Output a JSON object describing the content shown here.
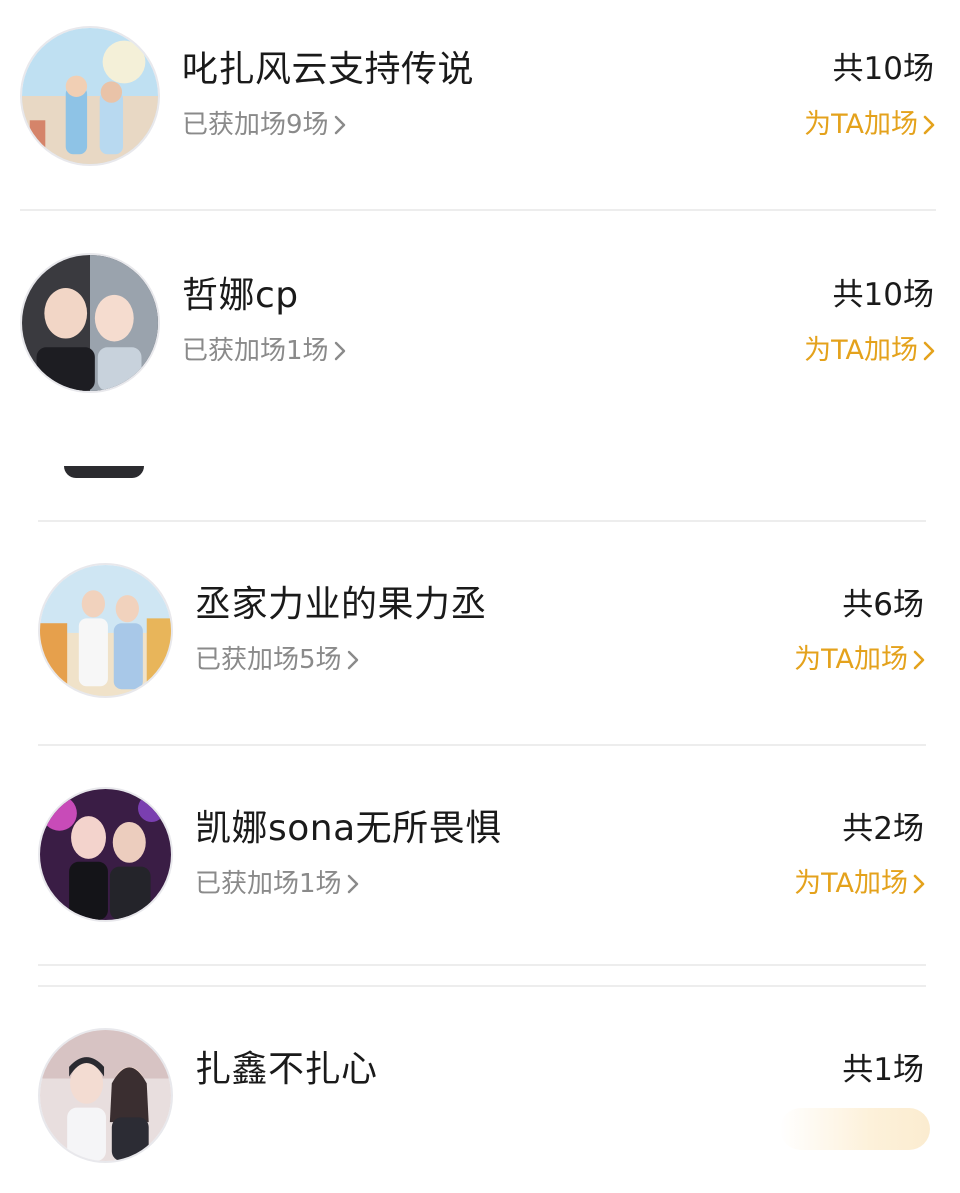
{
  "rows": [
    {
      "name": "叱扎风云支持传说",
      "earned": "已获加场9场",
      "total": "共10场",
      "action": "为TA加场"
    },
    {
      "name": "哲娜cp",
      "earned": "已获加场1场",
      "total": "共10场",
      "action": "为TA加场"
    },
    {
      "name": "丞家力业的果力丞",
      "earned": "已获加场5场",
      "total": "共6场",
      "action": "为TA加场"
    },
    {
      "name": "凯娜sona无所畏惧",
      "earned": "已获加场1场",
      "total": "共2场",
      "action": "为TA加场"
    },
    {
      "name": "扎鑫不扎心",
      "total": "共1场"
    }
  ],
  "colors": {
    "accent": "#e4a21c",
    "divider": "#ededed",
    "text": "#1a1a1a",
    "muted": "#8a8a8a"
  },
  "icons": {
    "earned_arrow": "chevron-right-icon",
    "action_arrow": "chevron-right-icon"
  }
}
